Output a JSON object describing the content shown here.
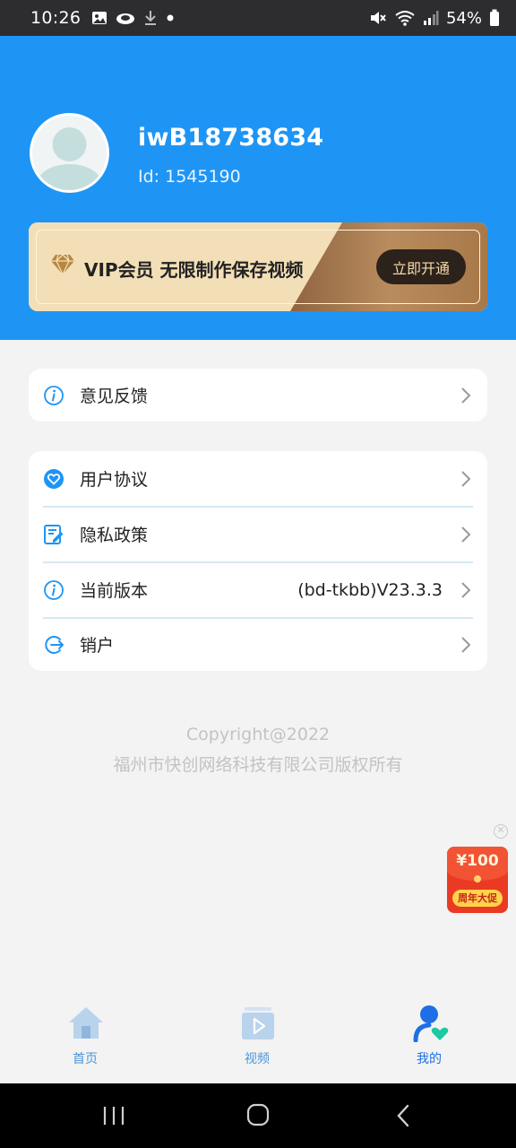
{
  "status_bar": {
    "time": "10:26",
    "battery": "54%",
    "left_icons": [
      "image-icon",
      "cloud-icon",
      "download-icon",
      "dot-icon"
    ],
    "right_icons": [
      "mute-icon",
      "wifi-icon",
      "signal-icon",
      "battery-icon"
    ]
  },
  "profile": {
    "username": "iwB18738634",
    "id_text": "Id: 1545190"
  },
  "vip_banner": {
    "text": "VIP会员 无限制作保存视频",
    "button_label": "立即开通"
  },
  "menu": {
    "feedback": {
      "label": "意见反馈",
      "icon": "info-icon"
    },
    "items": [
      {
        "label": "用户协议",
        "icon": "heart-badge-icon",
        "value": ""
      },
      {
        "label": "隐私政策",
        "icon": "document-edit-icon",
        "value": ""
      },
      {
        "label": "当前版本",
        "icon": "info-icon",
        "value": "(bd-tkbb)V23.3.3"
      },
      {
        "label": "销户",
        "icon": "logout-icon",
        "value": ""
      }
    ]
  },
  "footer": {
    "copyright": "Copyright@2022",
    "company": "福州市快创网络科技有限公司版权所有"
  },
  "promo": {
    "amount": "¥100",
    "tag": "周年大促"
  },
  "bottom_nav": {
    "items": [
      {
        "label": "首页",
        "icon": "home-icon",
        "active": false
      },
      {
        "label": "视频",
        "icon": "video-icon",
        "active": false
      },
      {
        "label": "我的",
        "icon": "profile-icon",
        "active": true
      }
    ]
  },
  "colors": {
    "primary": "#1e95f5",
    "nav_inactive": "#9ec4ea",
    "vip_gold": "#f3dfb7",
    "vip_bronze": "#a8784a",
    "promo_red": "#ea3a24"
  }
}
